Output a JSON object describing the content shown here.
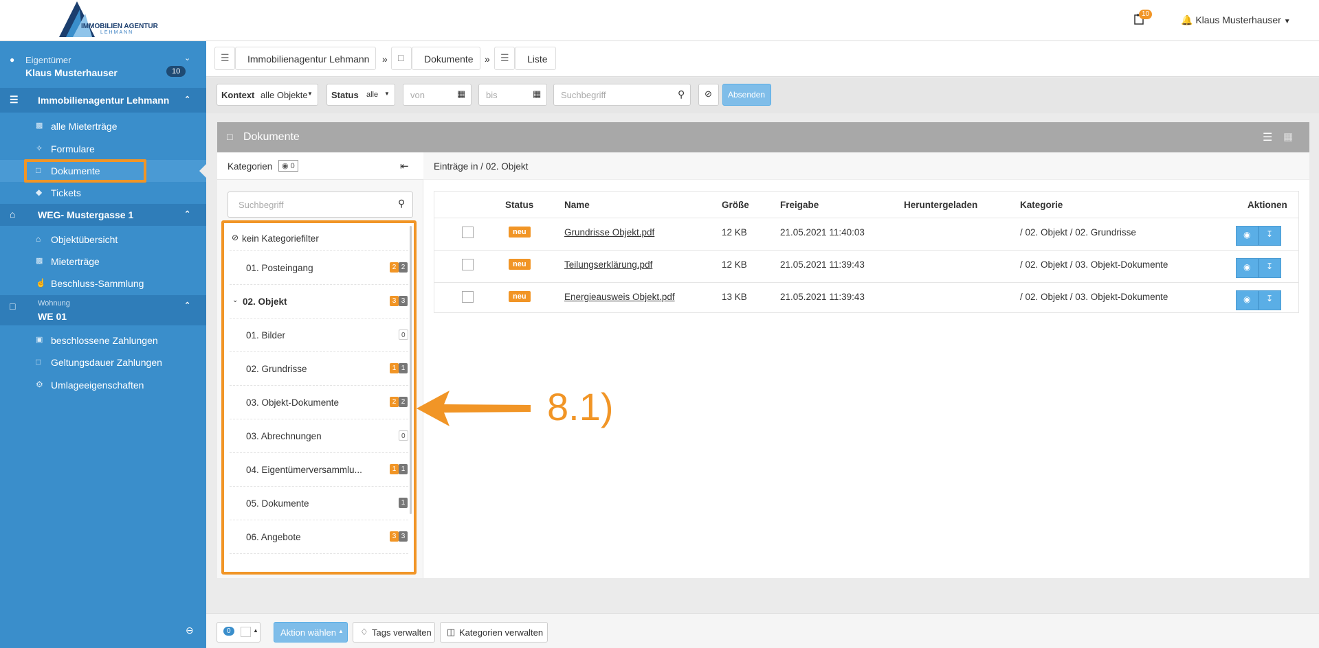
{
  "topbar": {
    "logo_line1": "IMMOBILIEN AGENTUR",
    "logo_line2": "LEHMANN",
    "notification_count": "10",
    "user_name": "Klaus Musterhauser"
  },
  "sidebar": {
    "role": "Eigentümer",
    "user": "Klaus Musterhauser",
    "user_count": "10",
    "section1": "Immobilienagentur Lehmann",
    "section1_items": [
      {
        "label": "alle Mieterträge",
        "icon": "chart-icon"
      },
      {
        "label": "Formulare",
        "icon": "wrench-icon"
      },
      {
        "label": "Dokumente",
        "icon": "file-icon"
      },
      {
        "label": "Tickets",
        "icon": "tag-icon"
      }
    ],
    "section2": "WEG- Mustergasse 1",
    "section2_items": [
      {
        "label": "Objektübersicht",
        "icon": "home-icon"
      },
      {
        "label": "Mieterträge",
        "icon": "chart-icon"
      },
      {
        "label": "Beschluss-Sammlung",
        "icon": "thumbs-up-icon"
      }
    ],
    "section3_small": "Wohnung",
    "section3": "WE 01",
    "section3_items": [
      {
        "label": "beschlossene Zahlungen",
        "icon": "money-icon"
      },
      {
        "label": "Geltungsdauer Zahlungen",
        "icon": "file-icon"
      },
      {
        "label": "Umlageeigenschaften",
        "icon": "gear-icon"
      }
    ]
  },
  "breadcrumb": {
    "items": [
      "Immobilienagentur Lehmann",
      "Dokumente",
      "Liste"
    ],
    "separator": "»"
  },
  "filters": {
    "kontext_label": "Kontext",
    "kontext_value": "alle Objekte",
    "status_label": "Status",
    "status_value": "alle",
    "von_placeholder": "von",
    "bis_placeholder": "bis",
    "search_placeholder": "Suchbegriff",
    "submit_label": "Absenden"
  },
  "panel": {
    "title": "Dokumente",
    "categories_label": "Kategorien",
    "categories_count": "0",
    "category_search_placeholder": "Suchbegriff",
    "entries_in": "Einträge in / 02. Objekt",
    "no_filter": "kein Kategoriefilter",
    "categories": [
      {
        "label": "01. Posteingang",
        "badges": [
          "2",
          "2"
        ],
        "style": "og",
        "bold": false,
        "indent": false
      },
      {
        "label": "02. Objekt",
        "badges": [
          "3",
          "3"
        ],
        "style": "og",
        "bold": true,
        "indent": true
      },
      {
        "label": "01. Bilder",
        "badges": [
          "0"
        ],
        "style": "w",
        "bold": false,
        "indent": false
      },
      {
        "label": "02. Grundrisse",
        "badges": [
          "1",
          "1"
        ],
        "style": "og",
        "bold": false,
        "indent": false
      },
      {
        "label": "03. Objekt-Dokumente",
        "badges": [
          "2",
          "2"
        ],
        "style": "og",
        "bold": false,
        "indent": false
      },
      {
        "label": "03. Abrechnungen",
        "badges": [
          "0"
        ],
        "style": "w",
        "bold": false,
        "indent": false
      },
      {
        "label": "04. Eigentümerversammlu...",
        "badges": [
          "1",
          "1"
        ],
        "style": "og",
        "bold": false,
        "indent": false
      },
      {
        "label": "05. Dokumente",
        "badges": [
          "1"
        ],
        "style": "g",
        "bold": false,
        "indent": false
      },
      {
        "label": "06. Angebote",
        "badges": [
          "3",
          "3"
        ],
        "style": "og",
        "bold": false,
        "indent": false
      }
    ]
  },
  "table": {
    "headers": [
      "Status",
      "Name",
      "Größe",
      "Freigabe",
      "Heruntergeladen",
      "Kategorie",
      "Aktionen"
    ],
    "rows": [
      {
        "status": "neu",
        "name": "Grundrisse Objekt.pdf",
        "size": "12 KB",
        "date": "21.05.2021 11:40:03",
        "downloaded": "",
        "category": "/ 02. Objekt / 02. Grundrisse"
      },
      {
        "status": "neu",
        "name": "Teilungserklärung.pdf",
        "size": "12 KB",
        "date": "21.05.2021 11:39:43",
        "downloaded": "",
        "category": "/ 02. Objekt / 03. Objekt-Dokumente"
      },
      {
        "status": "neu",
        "name": "Energieausweis Objekt.pdf",
        "size": "13 KB",
        "date": "21.05.2021 11:39:43",
        "downloaded": "",
        "category": "/ 02. Objekt / 03. Objekt-Dokumente"
      }
    ]
  },
  "bottombar": {
    "selected_count": "0",
    "action_label": "Aktion wählen",
    "tags_label": "Tags verwalten",
    "categories_label": "Kategorien verwalten"
  },
  "annotation": {
    "label": "8.1)"
  },
  "colors": {
    "accent_orange": "#f19526",
    "sidebar_blue": "#3a8ecb",
    "sidebar_dark": "#2f7db9",
    "button_blue": "#5aaee6"
  }
}
